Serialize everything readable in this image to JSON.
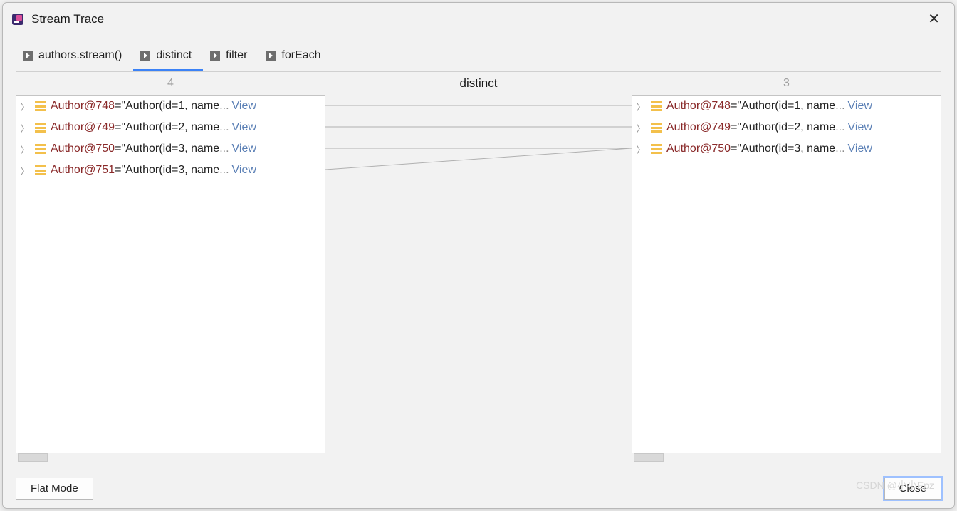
{
  "title": "Stream Trace",
  "tabs": [
    {
      "label": "authors.stream()"
    },
    {
      "label": "distinct"
    },
    {
      "label": "filter"
    },
    {
      "label": "forEach"
    }
  ],
  "active_tab": 1,
  "operation": "distinct",
  "left_count": "4",
  "right_count": "3",
  "left_items": [
    {
      "name": "Author@748",
      "value": "\"Author(id=1, name",
      "view": "View"
    },
    {
      "name": "Author@749",
      "value": "\"Author(id=2, name",
      "view": "View"
    },
    {
      "name": "Author@750",
      "value": "\"Author(id=3, name",
      "view": "View"
    },
    {
      "name": "Author@751",
      "value": "\"Author(id=3, name",
      "view": "View"
    }
  ],
  "right_items": [
    {
      "name": "Author@748",
      "value": "\"Author(id=1, name",
      "view": "View"
    },
    {
      "name": "Author@749",
      "value": "\"Author(id=2, name",
      "view": "View"
    },
    {
      "name": "Author@750",
      "value": "\"Author(id=3, name",
      "view": "View"
    }
  ],
  "connections": [
    {
      "from": 0,
      "to": 0
    },
    {
      "from": 1,
      "to": 1
    },
    {
      "from": 2,
      "to": 2
    },
    {
      "from": 3,
      "to": 2
    }
  ],
  "buttons": {
    "flat_mode": "Flat Mode",
    "close": "Close"
  },
  "watermark": "CSDN @小小Epz"
}
